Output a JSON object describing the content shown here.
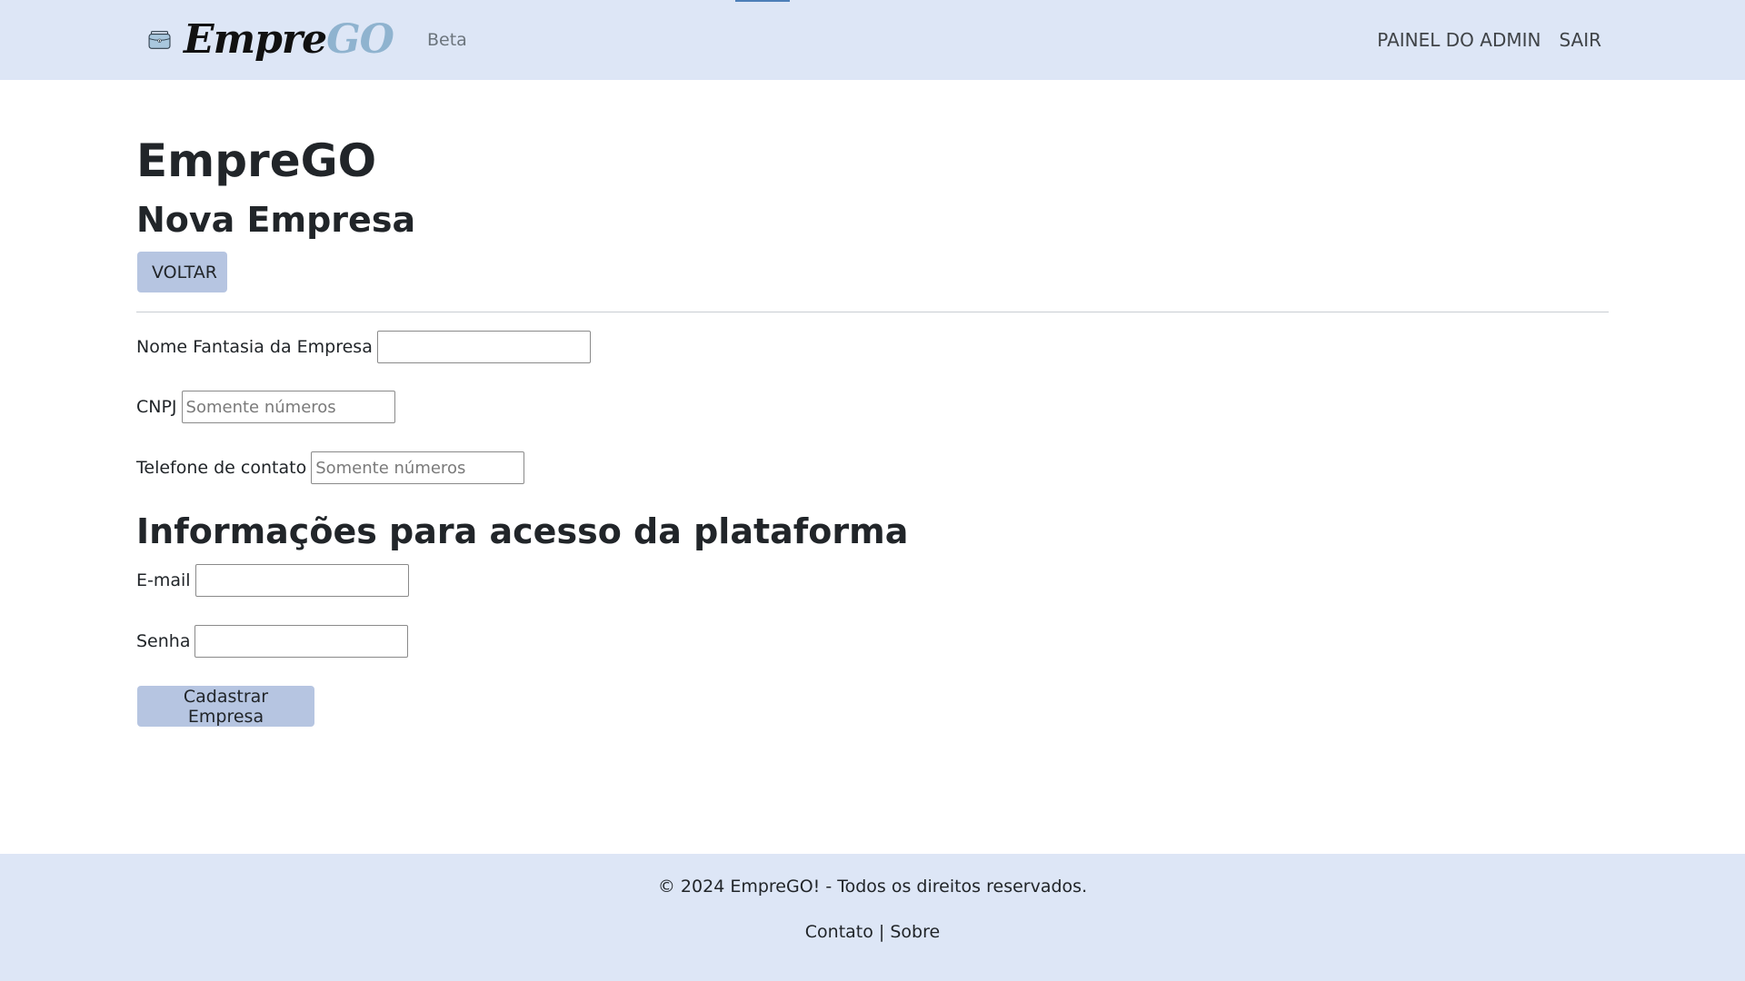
{
  "navbar": {
    "logo_text_dark": "Empre",
    "logo_text_light": "GO",
    "beta_label": "Beta",
    "links": [
      "PAINEL DO ADMIN",
      "SAIR"
    ]
  },
  "page": {
    "title": "EmpreGO",
    "subtitle": "Nova Empresa",
    "back_button": "VOLTAR"
  },
  "form": {
    "company": {
      "nome_label": "Nome Fantasia da Empresa",
      "nome_value": "",
      "cnpj_label": "CNPJ",
      "cnpj_placeholder": "Somente números",
      "telefone_label": "Telefone de contato",
      "telefone_placeholder": "Somente números"
    },
    "access_heading": "Informações para acesso da plataforma",
    "access": {
      "email_label": "E-mail",
      "email_value": "",
      "senha_label": "Senha",
      "senha_value": ""
    },
    "submit_label": "Cadastrar Empresa"
  },
  "footer": {
    "copyright": "© 2024 EmpreGO! - Todos os direitos reservados.",
    "links": [
      "Contato",
      "Sobre"
    ],
    "separator": "|"
  },
  "colors": {
    "nav_bg": "#dde6f6",
    "button_bg": "#b6c5e1",
    "logo_light": "#8fb3cf"
  },
  "icons": {
    "logo": "briefcase-icon"
  }
}
